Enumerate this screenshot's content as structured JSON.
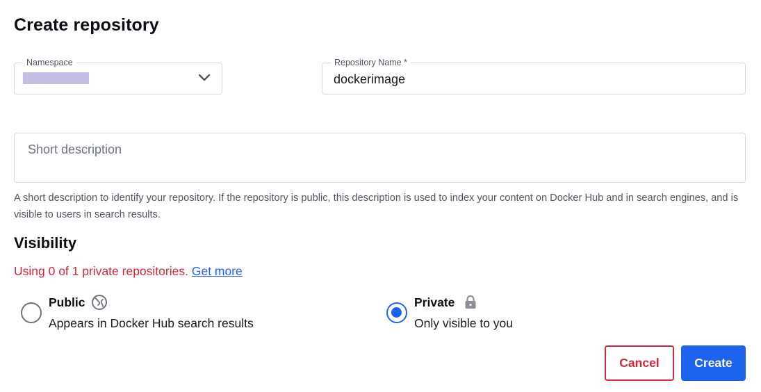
{
  "page": {
    "title": "Create repository"
  },
  "namespace": {
    "label": "Namespace",
    "value_redacted": true,
    "caret_icon": "chevron-down-icon"
  },
  "repository_name": {
    "label": "Repository Name *",
    "value": "dockerimage"
  },
  "short_description": {
    "placeholder": "Short description",
    "value": "",
    "helper": "A short description to identify your repository. If the repository is public, this description is used to index your content on Docker Hub and in search engines, and is visible to users in search results."
  },
  "visibility": {
    "heading": "Visibility",
    "usage_text": "Using 0 of 1 private repositories.",
    "get_more_link": "Get more",
    "options": [
      {
        "label": "Public",
        "description": "Appears in Docker Hub search results",
        "icon": "globe-icon",
        "selected": false
      },
      {
        "label": "Private",
        "description": "Only visible to you",
        "icon": "lock-icon",
        "selected": true
      }
    ]
  },
  "actions": {
    "cancel_label": "Cancel",
    "create_label": "Create"
  },
  "colors": {
    "primary": "#1d63ed",
    "danger": "#d4253b",
    "border": "#d6dae0",
    "text_muted": "#505660",
    "redaction": "#c5bde6"
  }
}
